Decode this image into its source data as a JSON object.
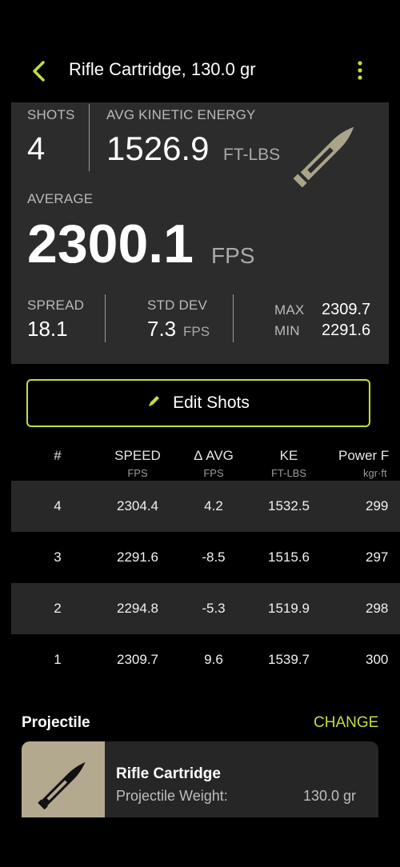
{
  "header": {
    "title": "Rifle Cartridge, 130.0 gr"
  },
  "summary": {
    "shots_label": "SHOTS",
    "shots_value": "4",
    "ke_label": "AVG KINETIC ENERGY",
    "ke_value": "1526.9",
    "ke_unit": "FT-LBS",
    "average_label": "AVERAGE",
    "average_value": "2300.1",
    "average_unit": "FPS",
    "spread_label": "SPREAD",
    "spread_value": "18.1",
    "stddev_label": "STD DEV",
    "stddev_value": "7.3",
    "stddev_unit": "FPS",
    "max_label": "MAX",
    "max_value": "2309.7",
    "min_label": "MIN",
    "min_value": "2291.6"
  },
  "edit_button": {
    "label": "Edit Shots",
    "icon": "pencil-icon"
  },
  "table": {
    "columns": [
      {
        "label": "#",
        "unit": ""
      },
      {
        "label": "SPEED",
        "unit": "FPS"
      },
      {
        "label": "Δ AVG",
        "unit": "FPS"
      },
      {
        "label": "KE",
        "unit": "FT-LBS"
      },
      {
        "label": "Power F",
        "unit": "kgr·ft"
      }
    ],
    "rows": [
      [
        "4",
        "2304.4",
        "4.2",
        "1532.5",
        "299"
      ],
      [
        "3",
        "2291.6",
        "-8.5",
        "1515.6",
        "297"
      ],
      [
        "2",
        "2294.8",
        "-5.3",
        "1519.9",
        "298"
      ],
      [
        "1",
        "2309.7",
        "9.6",
        "1539.7",
        "300"
      ]
    ]
  },
  "projectile": {
    "section_title": "Projectile",
    "change_label": "CHANGE",
    "name": "Rifle Cartridge",
    "weight_label": "Projectile Weight:",
    "weight_value": "130.0 gr"
  },
  "colors": {
    "accent": "#c6dc3f",
    "panel": "#2c2c2c",
    "bullet": "#a9a48a"
  }
}
